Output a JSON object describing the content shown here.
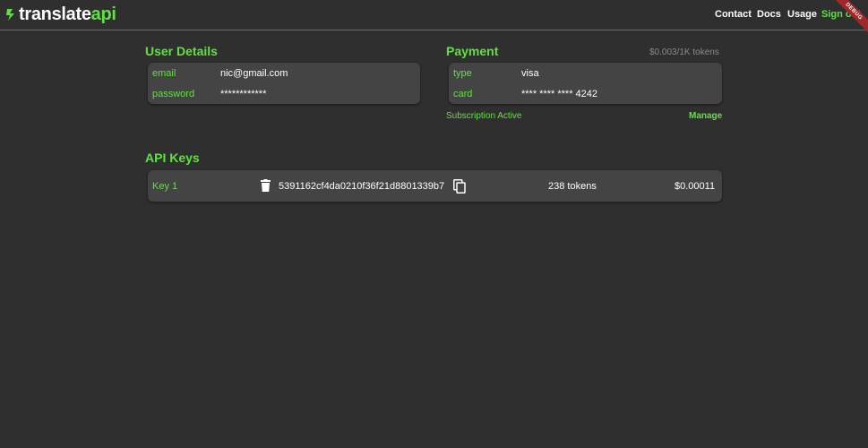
{
  "brand": {
    "part1": "translate",
    "part2": "api"
  },
  "nav": {
    "contact": "Contact",
    "docs": "Docs",
    "usage": "Usage",
    "signout": "Sign out"
  },
  "debug_banner": "DEBUG",
  "user_details": {
    "title": "User Details",
    "email_label": "email",
    "email_value": "nic@gmail.com",
    "password_label": "password",
    "password_value": "************"
  },
  "payment": {
    "title": "Payment",
    "rate": "$0.003/1K tokens",
    "type_label": "type",
    "type_value": "visa",
    "card_label": "card",
    "card_value": "**** **** **** 4242",
    "status": "Subscription Active",
    "manage_label": "Manage"
  },
  "api_keys": {
    "title": "API Keys",
    "items": [
      {
        "name": "Key 1",
        "key": "5391162cf4da0210f36f21d8801339b7",
        "tokens": "238 tokens",
        "cost": "$0.00011"
      }
    ]
  },
  "icons": {
    "delete": "trash-icon",
    "copy": "copy-icon",
    "logo": "logo-mark-icon"
  },
  "colors": {
    "accent": "#62e043",
    "background": "#2f2f2f",
    "card": "#444444",
    "debug": "#a0282b"
  }
}
